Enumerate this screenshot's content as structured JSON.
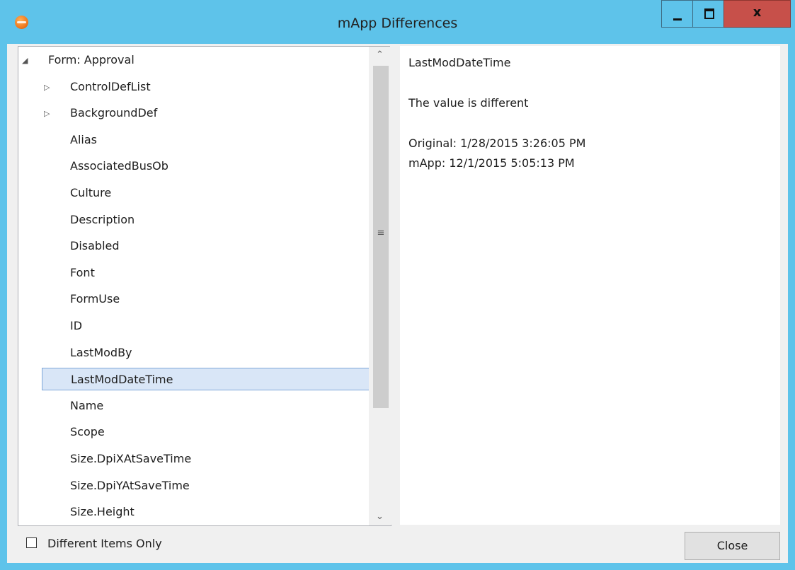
{
  "window": {
    "title": "mApp Differences",
    "close_glyph": "x"
  },
  "tree": {
    "root": {
      "label": "Form: Approval",
      "expanded": true
    },
    "items": [
      {
        "label": "ControlDefList",
        "expandable": true
      },
      {
        "label": "BackgroundDef",
        "expandable": true
      },
      {
        "label": "Alias",
        "expandable": false
      },
      {
        "label": "AssociatedBusOb",
        "expandable": false
      },
      {
        "label": "Culture",
        "expandable": false
      },
      {
        "label": "Description",
        "expandable": false
      },
      {
        "label": "Disabled",
        "expandable": false
      },
      {
        "label": "Font",
        "expandable": false
      },
      {
        "label": "FormUse",
        "expandable": false
      },
      {
        "label": "ID",
        "expandable": false
      },
      {
        "label": "LastModBy",
        "expandable": false
      },
      {
        "label": "LastModDateTime",
        "expandable": false,
        "selected": true
      },
      {
        "label": "Name",
        "expandable": false
      },
      {
        "label": "Scope",
        "expandable": false
      },
      {
        "label": "Size.DpiXAtSaveTime",
        "expandable": false
      },
      {
        "label": "Size.DpiYAtSaveTime",
        "expandable": false
      },
      {
        "label": "Size.Height",
        "expandable": false
      }
    ]
  },
  "details": {
    "heading": "LastModDateTime",
    "message": "The value is different",
    "original": "Original: 1/28/2015 3:26:05 PM",
    "mapp": "mApp: 12/1/2015 5:05:13 PM"
  },
  "footer": {
    "checkbox_label": "Different Items Only",
    "checkbox_checked": false,
    "close_label": "Close"
  },
  "colors": {
    "window_frame": "#5ec3ea",
    "close_button_red": "#c7504a",
    "selection": "#d9e6f7"
  },
  "icons": {
    "app": "app-logo-icon",
    "expanded": "triangle-expanded-icon",
    "collapsed": "triangle-collapsed-icon"
  }
}
